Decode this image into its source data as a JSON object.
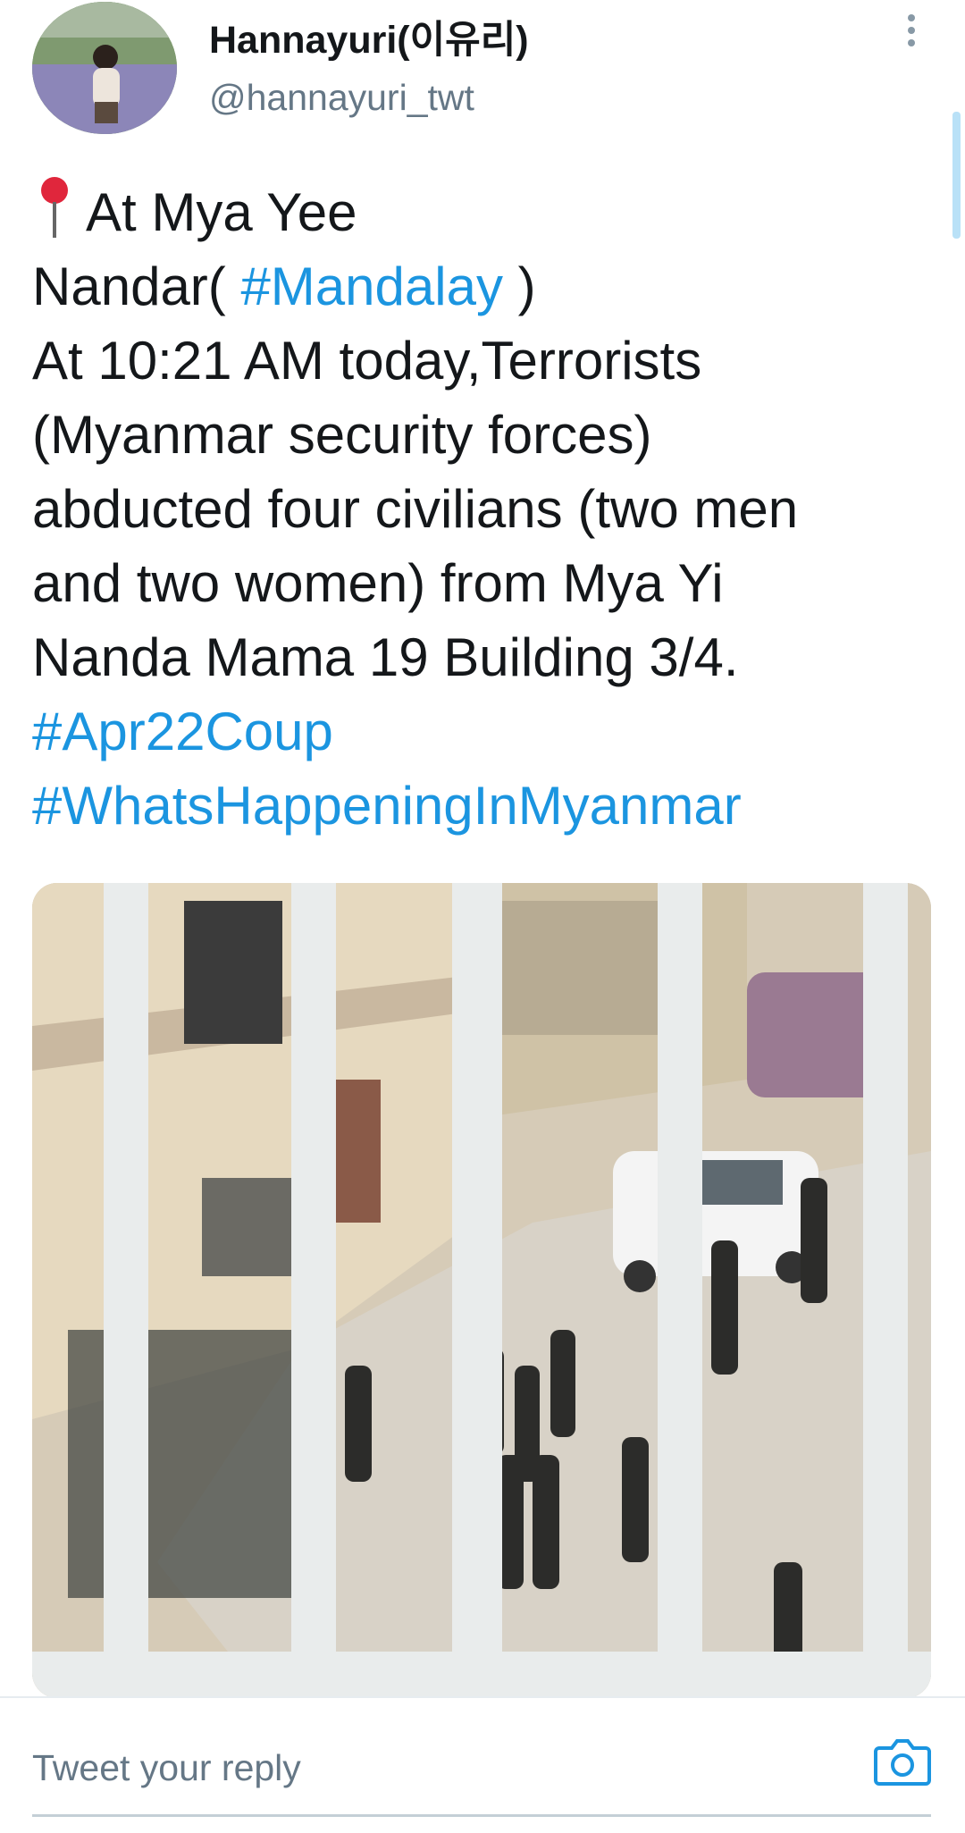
{
  "header": {
    "display_name": "Hannayuri(이유리)",
    "handle": "@hannayuri_twt"
  },
  "tweet": {
    "line1": "At Mya Yee",
    "line2_pre": "Nandar( ",
    "line2_tag": "#Mandalay",
    "line2_post": " )",
    "line3": "At 10:21 AM today,Terrorists",
    "line4": "(Myanmar security forces)",
    "line5": "abducted four civilians (two men",
    "line6": "and two women) from Mya Yi",
    "line7": "Nanda Mama 19 Building 3/4.",
    "hashtag1": "#Apr22Coup",
    "hashtag2": "#WhatsHappeningInMyanmar"
  },
  "reply": {
    "placeholder": "Tweet your reply"
  },
  "icons": {
    "location": "round-pushpin-icon",
    "more": "more-vertical-icon",
    "camera": "camera-icon"
  },
  "colors": {
    "link": "#1b95e0",
    "text": "#14171a",
    "secondary": "#657786"
  }
}
